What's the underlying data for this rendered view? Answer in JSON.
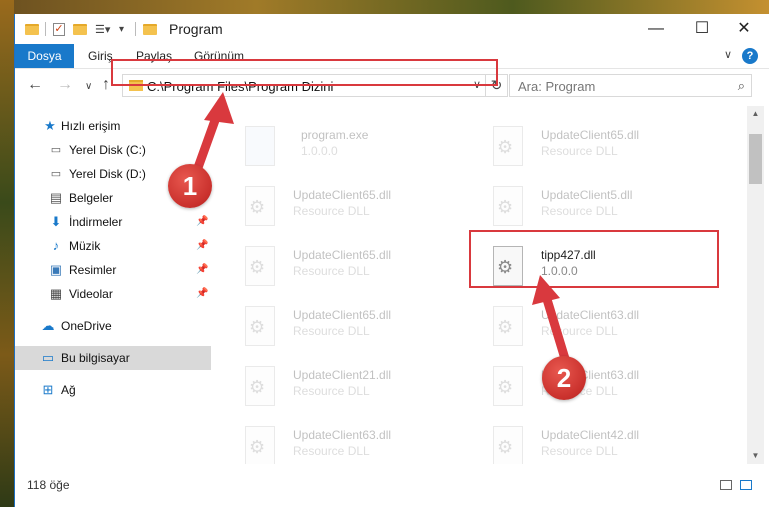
{
  "window": {
    "title": "Program",
    "minimize": "—",
    "maximize": "☐",
    "close": "✕"
  },
  "ribbon": {
    "tabs": [
      "Dosya",
      "Giriş",
      "Paylaş",
      "Görünüm"
    ],
    "help": "?",
    "expand": "∨"
  },
  "nav": {
    "back": "←",
    "forward": "→",
    "recent": "∨",
    "up": "↑",
    "address": "C:\\Program Files\\Program Dizini",
    "address_dropdown": "∨",
    "refresh": "↻",
    "search_placeholder": "Ara: Program",
    "search_icon": "⌕"
  },
  "sidebar": {
    "items": [
      {
        "label": "Hızlı erişim",
        "icon": "star-icon"
      },
      {
        "label": "Yerel Disk (C:)",
        "icon": "drive-icon"
      },
      {
        "label": "Yerel Disk (D:)",
        "icon": "drive-icon"
      },
      {
        "label": "Belgeler",
        "icon": "documents-icon"
      },
      {
        "label": "İndirmeler",
        "icon": "download-icon"
      },
      {
        "label": "Müzik",
        "icon": "music-icon"
      },
      {
        "label": "Resimler",
        "icon": "pictures-icon"
      },
      {
        "label": "Videolar",
        "icon": "video-icon"
      },
      {
        "label": "OneDrive",
        "icon": "cloud-icon"
      },
      {
        "label": "Bu bilgisayar",
        "icon": "computer-icon"
      },
      {
        "label": "Ağ",
        "icon": "network-icon"
      }
    ]
  },
  "files": {
    "col1": [
      {
        "name": "program.exe",
        "sub": "1.0.0.0"
      },
      {
        "name": "UpdateClient65.dll",
        "sub": "Resource DLL"
      },
      {
        "name": "UpdateClient65.dll",
        "sub": "Resource DLL"
      },
      {
        "name": "UpdateClient65.dll",
        "sub": "Resource DLL"
      },
      {
        "name": "UpdateClient21.dll",
        "sub": "Resource DLL"
      },
      {
        "name": "UpdateClient63.dll",
        "sub": "Resource DLL"
      }
    ],
    "col2": [
      {
        "name": "UpdateClient65.dll",
        "sub": "Resource DLL"
      },
      {
        "name": "UpdateClient5.dll",
        "sub": "Resource DLL"
      },
      {
        "name": "tipp427.dll",
        "sub": "1.0.0.0"
      },
      {
        "name": "UpdateClient63.dll",
        "sub": "Resource DLL"
      },
      {
        "name": "UpdateClient63.dll",
        "sub": "Resource DLL"
      },
      {
        "name": "UpdateClient42.dll",
        "sub": "Resource DLL"
      }
    ]
  },
  "status": {
    "count": "118 öğe"
  },
  "callouts": {
    "one": "1",
    "two": "2"
  },
  "colors": {
    "accent": "#1979ca",
    "highlight": "#d9393e"
  }
}
